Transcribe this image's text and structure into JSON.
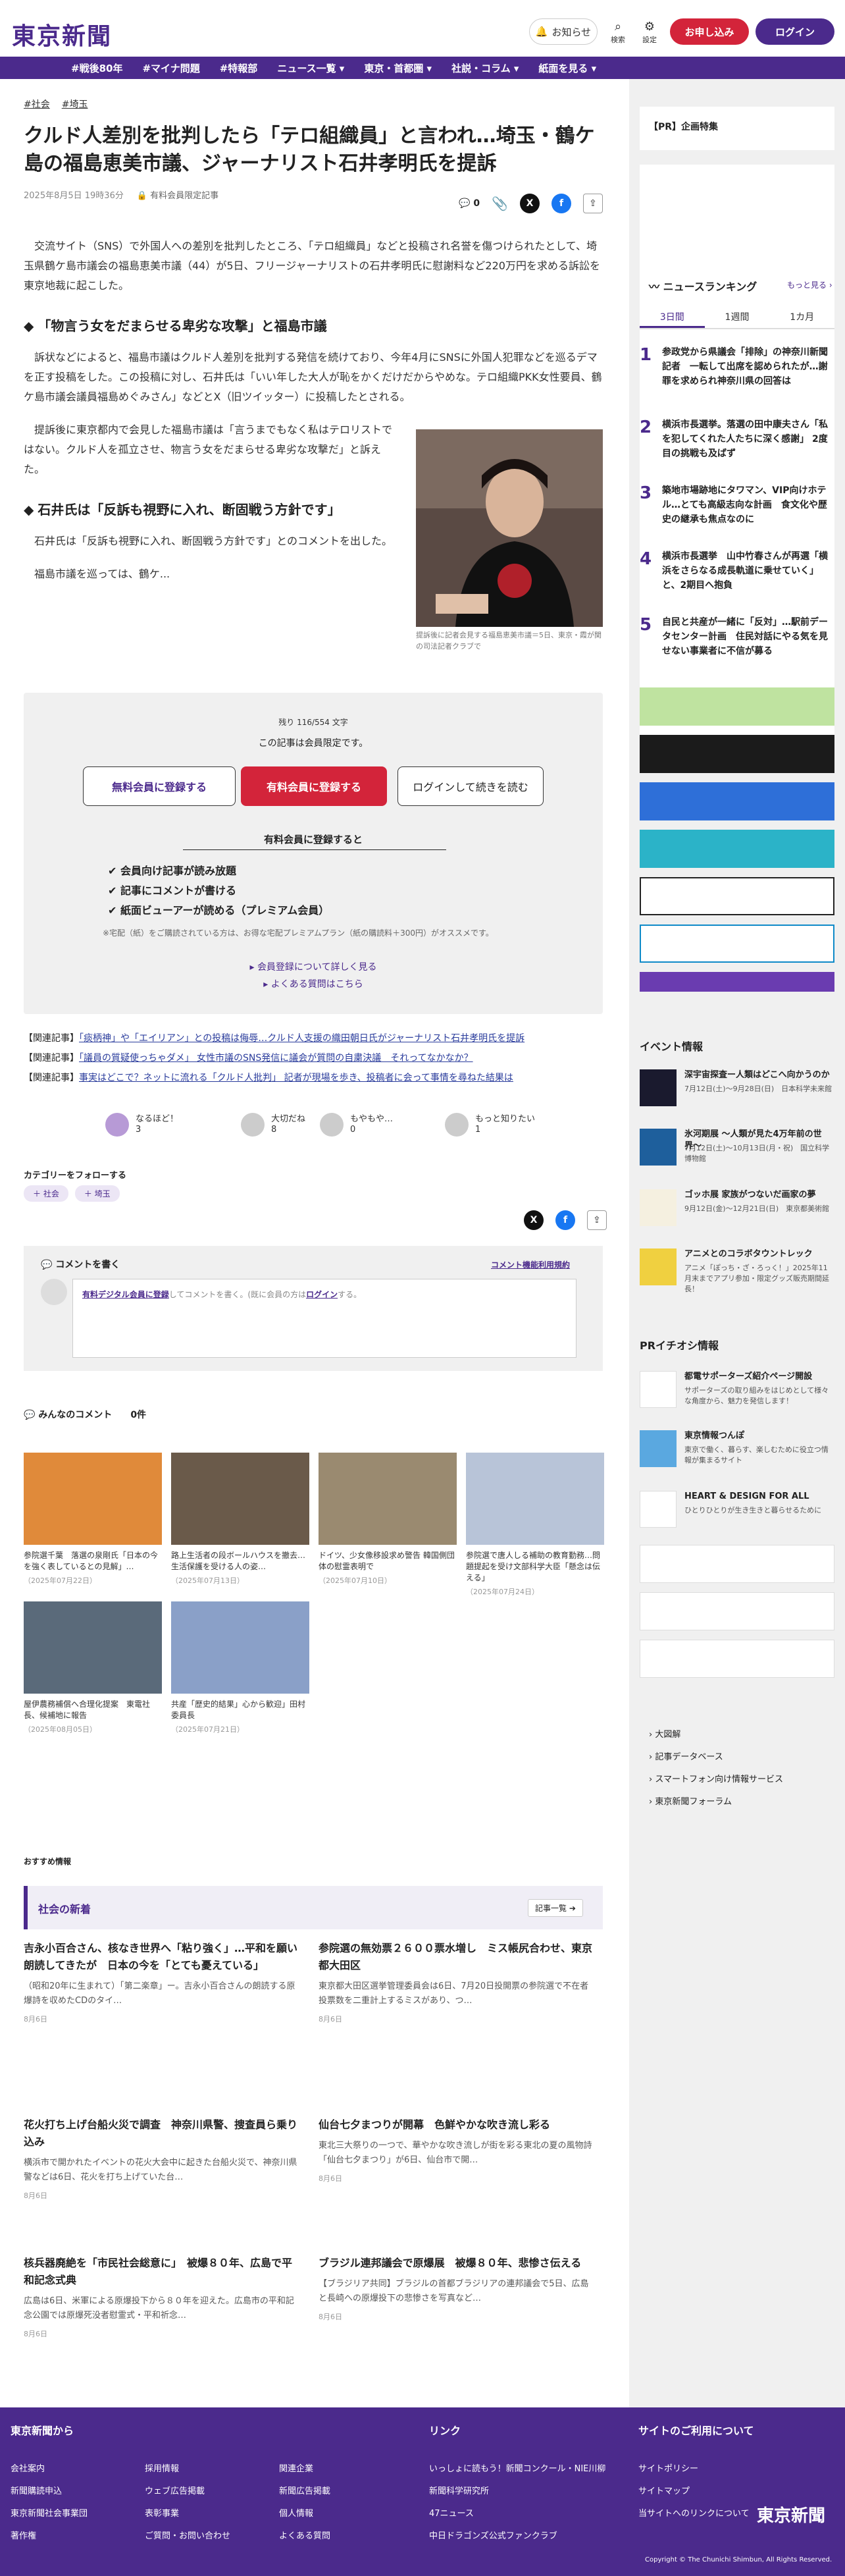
{
  "header": {
    "logo": "東京新聞",
    "notice": "お知らせ",
    "search": "検索",
    "settings": "設定",
    "apply": "お申し込み",
    "login": "ログイン"
  },
  "nav": [
    "#戦後80年",
    "#マイナ問題",
    "#特報部",
    "ニュース一覧 ▾",
    "東京・首都圏 ▾",
    "社説・コラム ▾",
    "紙面を見る ▾"
  ],
  "article": {
    "tags": [
      "#社会",
      "#埼玉"
    ],
    "title": "クルド人差別を批判したら「テロ組織員」と言われ…埼玉・鶴ケ島の福島恵美市議、ジャーナリスト石井孝明氏を提訴",
    "date": "2025年8月5日 19時36分",
    "member_only": "有料会員限定記事",
    "comment_count": "0",
    "p1": "交流サイト（SNS）で外国人への差別を批判したところ、「テロ組織員」などと投稿され名誉を傷つけられたとして、埼玉県鶴ケ島市議会の福島恵美市議（44）が5日、フリージャーナリストの石井孝明氏に慰謝料など220万円を求める訴訟を東京地裁に起こした。",
    "h1": "「物言う女をだまらせる卑劣な攻撃」と福島市議",
    "p2": "訴状などによると、福島市議はクルド人差別を批判する発信を続けており、今年4月にSNSに外国人犯罪などを巡るデマを正す投稿をした。この投稿に対し、石井氏は「いい年した大人が恥をかくだけだからやめな。テロ組織PKK女性要員、鶴ケ島市議会議員福島めぐみさん」などとX（旧ツイッター）に投稿したとされる。",
    "p3": "提訴後に東京都内で会見した福島市議は「言うまでもなく私はテロリストではない。クルド人を孤立させ、物言う女をだまらせる卑劣な攻撃だ」と訴えた。",
    "h2": "石井氏は「反訴も視野に入れ、断固戦う方針です」",
    "p4": "石井氏は「反訴も視野に入れ、断固戦う方針です」とのコメントを出した。",
    "p5": "福島市議を巡っては、鶴ケ...",
    "photo_caption": "提訴後に記者会見する福島恵美市議＝5日、東京・霞が関の司法記者クラブで"
  },
  "paywall": {
    "remain": "残り 116/554 文字",
    "limit": "この記事は会員限定です。",
    "free_btn": "無料会員に登録する",
    "paid_btn": "有料会員に登録する",
    "login_btn": "ログインして続きを読む",
    "benefit_title": "有料会員に登録すると",
    "benefits": [
      "会員向け記事が読み放題",
      "記事にコメントが書ける",
      "紙面ビューアーが読める（プレミアム会員）"
    ],
    "note": "※宅配（紙）をご購読されている方は、お得な宅配プレミアムプラン（紙の購読料＋300円）がオススメです。",
    "link1": "会員登録について詳しく見る",
    "link2": "よくある質問はこちら"
  },
  "related": [
    {
      "pre": "【関連記事】",
      "text": "「痰柄神」や「エイリアン」との投稿は侮辱…クルド人支援の織田朝日氏がジャーナリスト石井孝明氏を提訴"
    },
    {
      "pre": "【関連記事】",
      "text": "「議員の質疑使っちゃダメ」 女性市議のSNS発信に議会が質問の自粛決議　それってなかなか？"
    },
    {
      "pre": "【関連記事】",
      "text": "事実はどこで？ネットに流れる「クルド人批判」 記者が現場を歩き、投稿者に会って事情を尋ねた結果は"
    }
  ],
  "reactions": [
    {
      "label": "なるほど！",
      "count": "3"
    },
    {
      "label": "大切だね",
      "count": "8"
    },
    {
      "label": "もやもや…",
      "count": "0"
    },
    {
      "label": "もっと知りたい",
      "count": "1"
    }
  ],
  "follow": {
    "label": "カテゴリーをフォローする",
    "tags": [
      "社会",
      "埼玉"
    ]
  },
  "comment_box": {
    "title": "コメントを書く",
    "rules": "コメント機能利用規約",
    "prompt_link": "有料デジタル会員に登録",
    "prompt_mid": "してコメントを書く。(既に会員の方は",
    "prompt_login": "ログイン",
    "prompt_end": "する。"
  },
  "comments": {
    "title": "みんなのコメント",
    "count": "0件"
  },
  "thumbs": [
    {
      "cap": "参院選千葉　落選の泉剛氏「日本の今を強く表しているとの見解」…",
      "date": "（2025年07月22日）"
    },
    {
      "cap": "路上生活者の段ボールハウスを撤去…生活保護を受ける人の姿…",
      "date": "（2025年07月13日）"
    },
    {
      "cap": "ドイツ、少女像移設求め警告 韓国側団体の慰霊表明で",
      "date": "（2025年07月10日）"
    },
    {
      "cap": "参院選で唐人しる補助の教育勤務…問題提起を受け文部科学大臣「懸念は伝える」",
      "date": "（2025年07月24日）"
    },
    {
      "cap": "屋伊農務補償へ合理化提案　東電社長、候補地に報告",
      "date": "（2025年08月05日）"
    },
    {
      "cap": "共産「歴史的結果」心から歓迎」田村委員長",
      "date": "（2025年07月21日）"
    }
  ],
  "recommend": "おすすめ情報",
  "society": {
    "title": "社会の新着",
    "more": "記事一覧",
    "items": [
      {
        "hd": "吉永小百合さん、核なき世界へ「粘り強く」…平和を願い朗読してきたが　日本の今を「とても憂えている」",
        "bd": "（昭和20年に生まれて）「第二楽章」ー。吉永小百合さんの朗読する原爆詩を収めたCDのタイ…",
        "dt": "8月6日"
      },
      {
        "hd": "参院選の無効票２６００票水増し　ミス帳尻合わせ、東京都大田区",
        "bd": "東京都大田区選挙管理委員会は6日、7月20日投開票の参院選で不在者投票数を二重計上するミスがあり、つ…",
        "dt": "8月6日"
      },
      {
        "hd": "花火打ち上げ台船火災で調査　神奈川県警、捜査員ら乗り込み",
        "bd": "横浜市で開かれたイベントの花火大会中に起きた台船火災で、神奈川県警などは6日、花火を打ち上げていた台…",
        "dt": "8月6日"
      },
      {
        "hd": "仙台七夕まつりが開幕　色鮮やかな吹き流し彩る",
        "bd": "東北三大祭りの一つで、華やかな吹き流しが街を彩る東北の夏の風物詩「仙台七夕まつり」が6日、仙台市で開…",
        "dt": "8月6日"
      },
      {
        "hd": "核兵器廃絶を「市民社会総意に」　被爆８０年、広島で平和記念式典",
        "bd": "広島は6日、米軍による原爆投下から８０年を迎えた。広島市の平和記念公園では原爆死没者慰霊式・平和祈念…",
        "dt": "8月6日"
      },
      {
        "hd": "ブラジル連邦議会で原爆展　被爆８０年、悲惨さ伝える",
        "bd": "【ブラジリア共同】ブラジルの首都ブラジリアの連邦議会で5日、広島と長崎への原爆投下の悲惨さを写真など…",
        "dt": "8月6日"
      }
    ]
  },
  "sidebar": {
    "pr": "【PR】企画特集",
    "ranking_title": "ニュースランキング",
    "ranking_more": "もっと見る",
    "tabs": [
      "3日間",
      "1週間",
      "1カ月"
    ],
    "ranking": [
      {
        "n": "1",
        "t": "参政党から県議会「排除」の神奈川新聞記者　一転して出席を認められたが…謝罪を求められ神奈川県の回答は"
      },
      {
        "n": "2",
        "t": "横浜市長選挙。落選の田中康夫さん「私を犯してくれた人たちに深く感謝」 2度目の挑戦も及ばず"
      },
      {
        "n": "3",
        "t": "築地市場跡地にタワマン、VIP向けホテル…とても高級志向な計画　食文化や歴史の継承も焦点なのに"
      },
      {
        "n": "4",
        "t": "横浜市長選挙　山中竹春さんが再選「横浜をさらなる成長軌道に乗せていく」と、2期目へ抱負"
      },
      {
        "n": "5",
        "t": "自民と共産が一緒に「反対」…駅前データセンター計画　住民対話にやる気を見せない事業者に不信が募る"
      }
    ],
    "events_title": "イベント情報",
    "events": [
      {
        "t": "深宇宙探査ー人類はどこへ向かうのか",
        "d": "7月12日(土)〜9月28日(日)　日本科学未来館"
      },
      {
        "t": "氷河期展 〜人類が見た4万年前の世界〜",
        "d": "7月12日(土)〜10月13日(月・祝)　国立科学博物館"
      },
      {
        "t": "ゴッホ展 家族がつないだ画家の夢",
        "d": "9月12日(金)〜12月21日(日)　東京都美術館"
      },
      {
        "t": "アニメとのコラボタウントレック",
        "d": "アニメ「ぽっち・ざ・ろっく！」2025年11月末までアプリ参加・限定グッズ販売期間延長！"
      }
    ],
    "pr_title": "PRイチオシ情報",
    "pr_items": [
      {
        "t": "都電サポーターズ紹介ページ開設",
        "d": "サポーターズの取り組みをはじめとして様々な角度から、魅力を発信します！"
      },
      {
        "t": "東京情報つんぽ",
        "d": "東京で働く、暮らす、楽しむために役立つ情報が集まるサイト"
      },
      {
        "t": "HEART & DESIGN FOR ALL",
        "d": "ひとりひとりが生き生きと暮らせるために"
      }
    ],
    "links": [
      "大図解",
      "記事データベース",
      "スマートフォン向け情報サービス",
      "東京新聞フォーラム"
    ]
  },
  "footer": {
    "col1_title": "東京新聞から",
    "col1": [
      [
        "会社案内",
        "採用情報",
        "関連企業"
      ],
      [
        "新聞購読申込",
        "ウェブ広告掲載",
        "新聞広告掲載"
      ],
      [
        "東京新聞社会事業団",
        "表彰事業",
        "個人情報"
      ],
      [
        "著作権",
        "ご質問・お問い合わせ",
        "よくある質問"
      ]
    ],
    "col2_title": "リンク",
    "col2": [
      "いっしょに読もう！新聞コンクール・NIE川柳",
      "新聞科学研究所",
      "47ニュース",
      "中日ドラゴンズ公式ファンクラブ"
    ],
    "col3_title": "サイトのご利用について",
    "col3": [
      "サイトポリシー",
      "サイトマップ",
      "当サイトへのリンクについて"
    ],
    "logo": "東京新聞",
    "copyright": "Copyright © The Chunichi Shimbun, All Rights Reserved."
  },
  "colors": {
    "brand": "#4b2a8c",
    "accent": "#d3243a"
  }
}
